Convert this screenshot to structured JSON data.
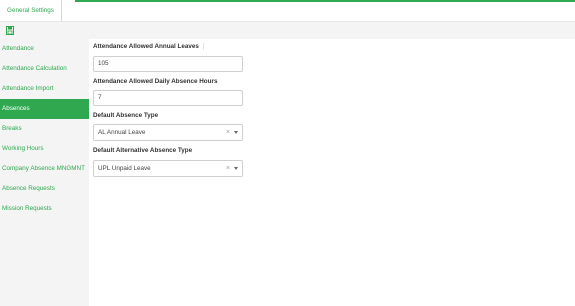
{
  "tabs": {
    "active_label": "General Settings"
  },
  "toolbar": {
    "save_icon": "save-icon"
  },
  "sidebar": {
    "items": [
      {
        "label": "Attendance"
      },
      {
        "label": "Attendance Calculation"
      },
      {
        "label": "Attendance Import"
      },
      {
        "label": "Absences"
      },
      {
        "label": "Breaks"
      },
      {
        "label": "Working Hours"
      },
      {
        "label": "Company Absence MNGMNT"
      },
      {
        "label": "Absence Requests"
      },
      {
        "label": "Mission Requests"
      }
    ],
    "active_index": 3
  },
  "form": {
    "annual_leaves_label": "Attendance Allowed Annual Leaves",
    "annual_leaves_value": "105",
    "daily_absence_label": "Attendance Allowed Daily Absence Hours",
    "daily_absence_value": "7",
    "absence_type_label": "Default Absence Type",
    "absence_type_value": "AL Annual Leave",
    "alt_absence_type_label": "Default Alternative Absence Type",
    "alt_absence_type_value": "UPL Unpaid Leave",
    "clear_symbol": "×"
  },
  "colors": {
    "accent": "#2fa84f",
    "sidebar_bg": "#f4f4f4",
    "toolbar_bg": "#f4f4f4"
  }
}
